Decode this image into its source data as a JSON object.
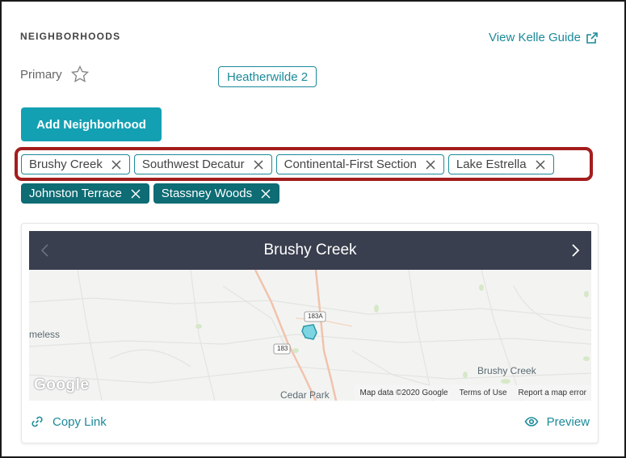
{
  "section": {
    "title": "NEIGHBORHOODS",
    "guide_link": "View Kelle Guide"
  },
  "primary": {
    "label": "Primary",
    "neighborhood": "Heatherwilde 2"
  },
  "add_button": "Add Neighborhood",
  "tags_row1": [
    "Brushy Creek",
    "Southwest Decatur",
    "Continental-First Section",
    "Lake Estrella"
  ],
  "tags_row2": [
    "Johnston Terrace",
    "Stassney Woods"
  ],
  "map_card": {
    "title": "Brushy Creek",
    "labels": {
      "left_place": "meless",
      "cedar_park": "Cedar Park",
      "brushy_creek": "Brushy Creek",
      "shield_183a": "183A",
      "shield_183": "183"
    },
    "logo": "Google",
    "attribution": {
      "map_data": "Map data ©2020 Google",
      "terms": "Terms of Use",
      "report": "Report a map error"
    },
    "copy_link": "Copy Link",
    "preview": "Preview"
  },
  "colors": {
    "teal": "#1b8a99",
    "teal_button": "#14a0b3",
    "teal_dark": "#0d6c74",
    "header_bg": "#3a3f4f",
    "highlight": "#a31d1d"
  },
  "icons": {
    "external": "external-link-icon",
    "star": "star-outline-icon",
    "remove": "close-icon",
    "prev": "chevron-left-icon",
    "next": "chevron-right-icon",
    "link": "link-icon",
    "eye": "eye-icon"
  }
}
